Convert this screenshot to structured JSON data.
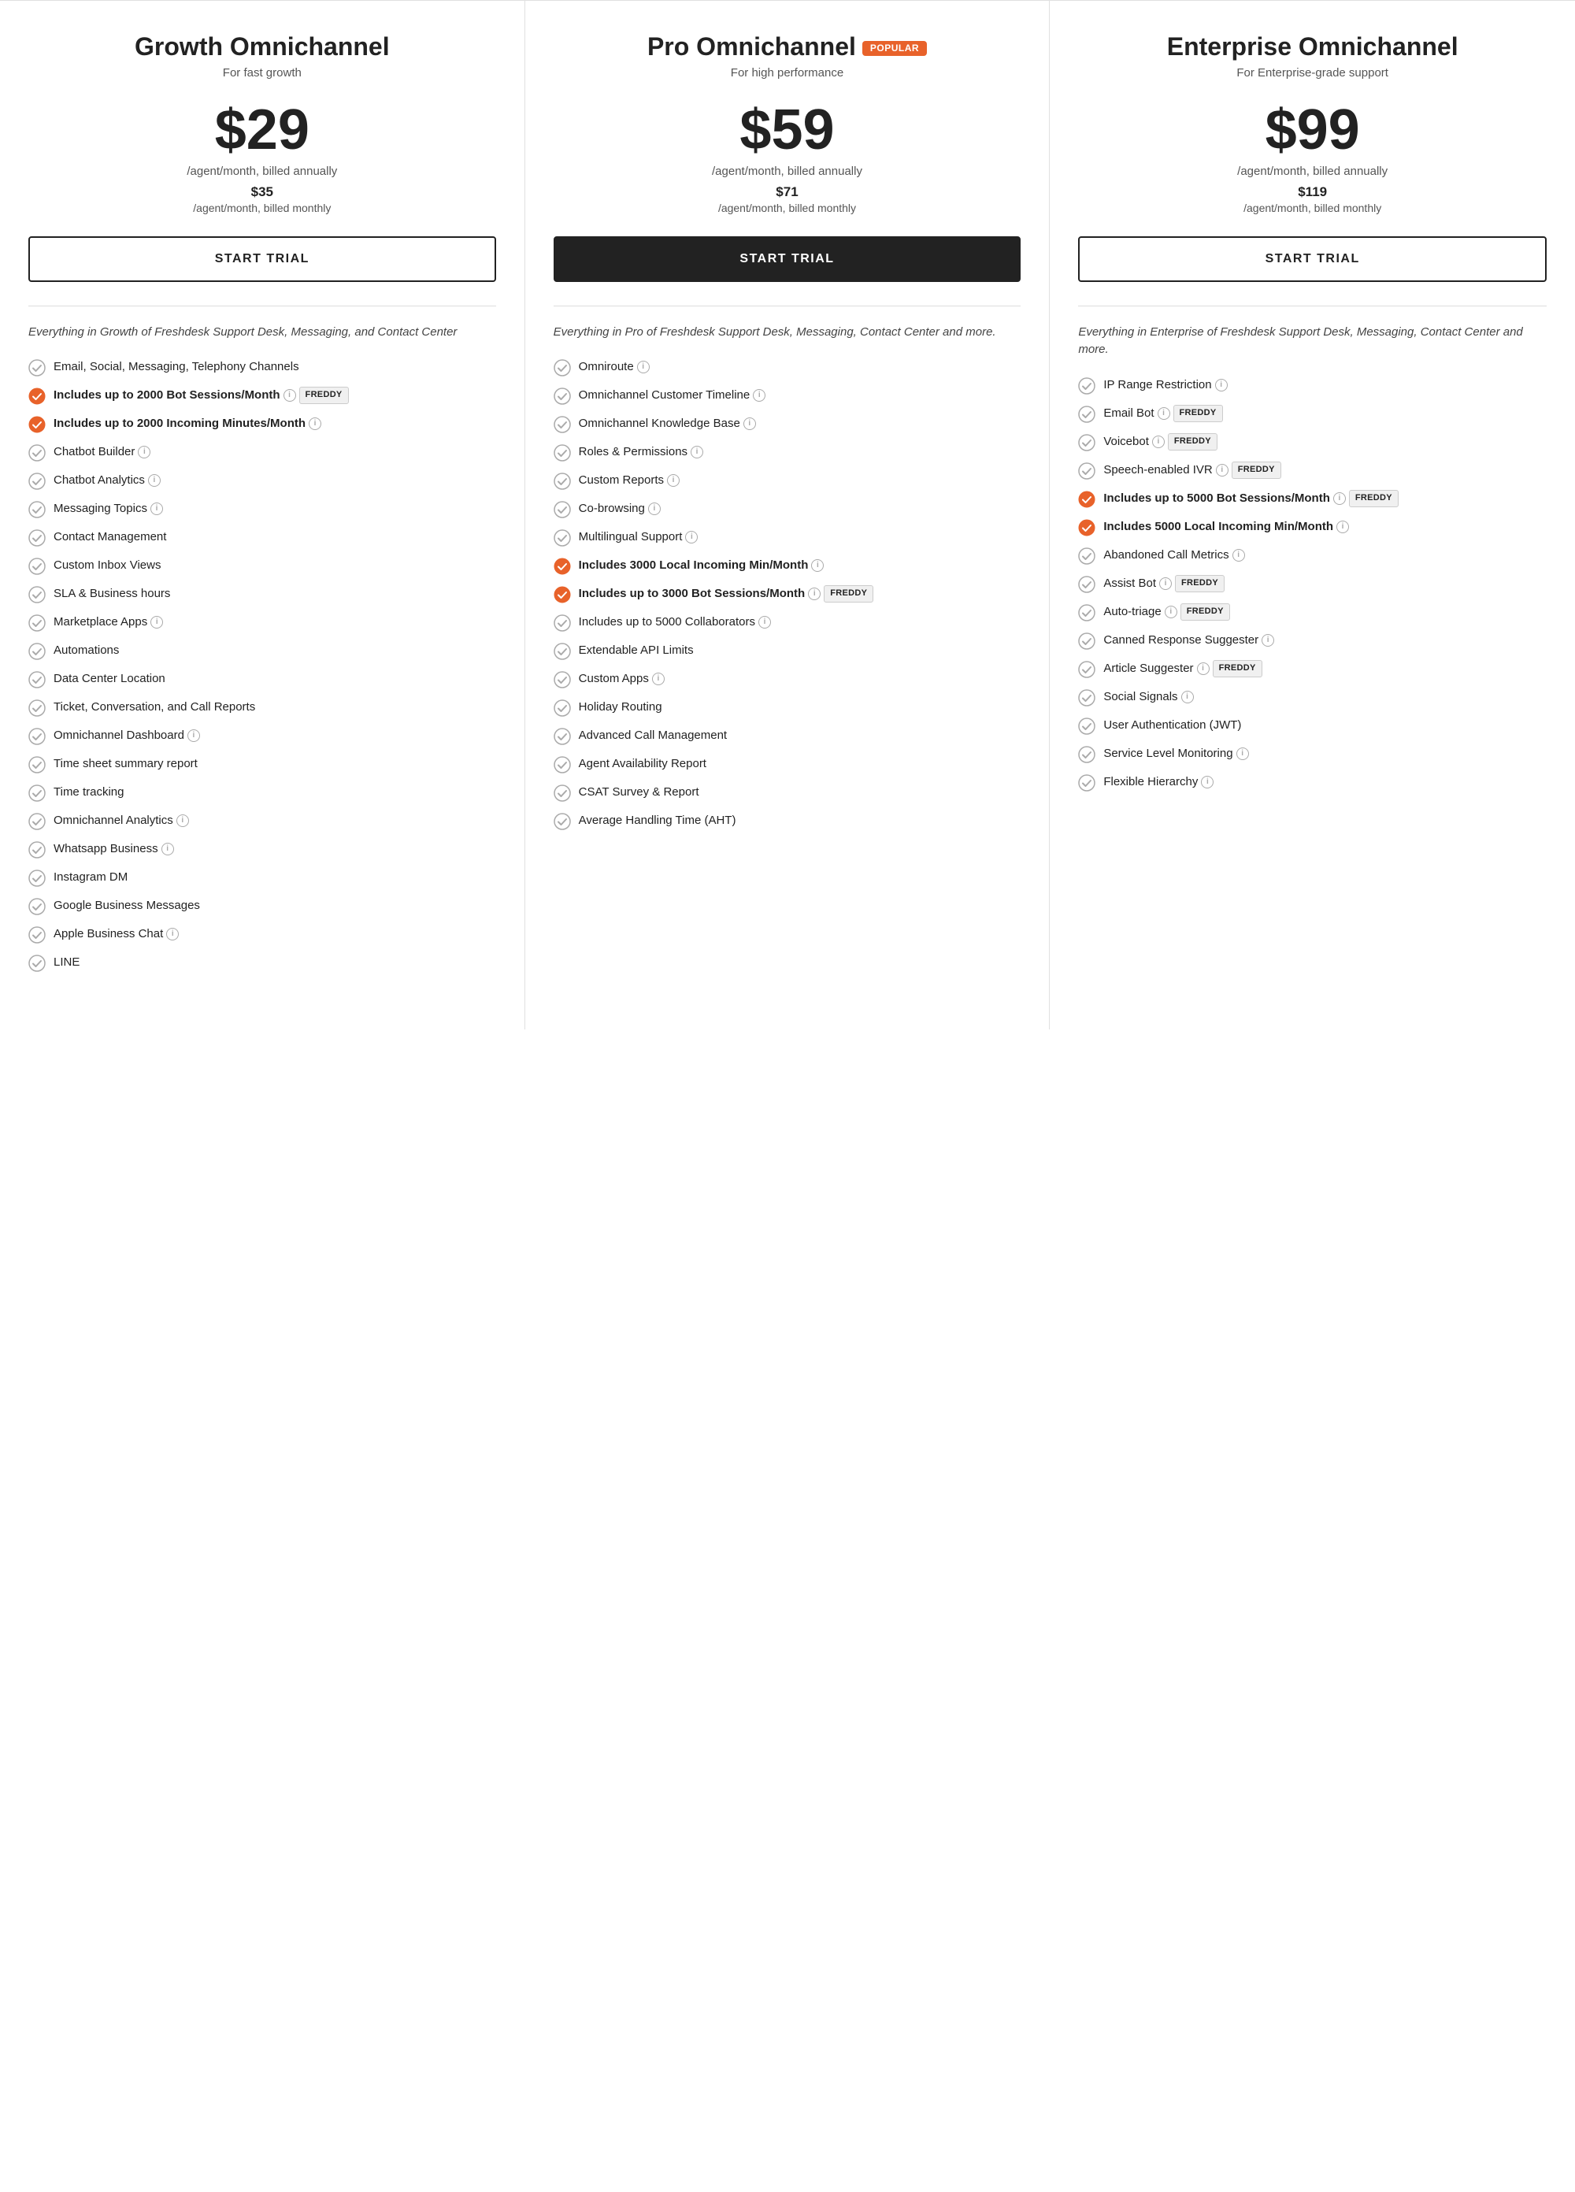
{
  "plans": [
    {
      "id": "growth",
      "name": "Growth Omnichannel",
      "tagline": "For fast growth",
      "popular": false,
      "price": "$29",
      "priceAnnual": "/agent/month, billed annually",
      "priceMonthlyVal": "$35",
      "priceMonthlyLabel": "/agent/month, billed monthly",
      "trialLabel": "START TRIAL",
      "trialStyle": "outline",
      "includes": "Everything in Growth of Freshdesk Support Desk, Messaging, and Contact Center",
      "features": [
        {
          "text": "Email, Social, Messaging, Telephony Channels",
          "bold": false,
          "orange": false,
          "info": false,
          "freddy": false
        },
        {
          "text": "Includes up to 2000 Bot Sessions/Month",
          "bold": true,
          "orange": true,
          "info": true,
          "freddy": true
        },
        {
          "text": "Includes up to 2000 Incoming Minutes/Month",
          "bold": true,
          "orange": true,
          "info": true,
          "freddy": false
        },
        {
          "text": "Chatbot Builder",
          "bold": false,
          "orange": false,
          "info": true,
          "freddy": false
        },
        {
          "text": "Chatbot Analytics",
          "bold": false,
          "orange": false,
          "info": true,
          "freddy": false
        },
        {
          "text": "Messaging Topics",
          "bold": false,
          "orange": false,
          "info": true,
          "freddy": false
        },
        {
          "text": "Contact Management",
          "bold": false,
          "orange": false,
          "info": false,
          "freddy": false
        },
        {
          "text": "Custom Inbox Views",
          "bold": false,
          "orange": false,
          "info": false,
          "freddy": false
        },
        {
          "text": "SLA & Business hours",
          "bold": false,
          "orange": false,
          "info": false,
          "freddy": false
        },
        {
          "text": "Marketplace Apps",
          "bold": false,
          "orange": false,
          "info": true,
          "freddy": false
        },
        {
          "text": "Automations",
          "bold": false,
          "orange": false,
          "info": false,
          "freddy": false
        },
        {
          "text": "Data Center Location",
          "bold": false,
          "orange": false,
          "info": false,
          "freddy": false
        },
        {
          "text": "Ticket, Conversation, and Call Reports",
          "bold": false,
          "orange": false,
          "info": false,
          "freddy": false
        },
        {
          "text": "Omnichannel Dashboard",
          "bold": false,
          "orange": false,
          "info": true,
          "freddy": false
        },
        {
          "text": "Time sheet summary report",
          "bold": false,
          "orange": false,
          "info": false,
          "freddy": false
        },
        {
          "text": "Time tracking",
          "bold": false,
          "orange": false,
          "info": false,
          "freddy": false
        },
        {
          "text": "Omnichannel Analytics",
          "bold": false,
          "orange": false,
          "info": true,
          "freddy": false
        },
        {
          "text": "Whatsapp Business",
          "bold": false,
          "orange": false,
          "info": true,
          "freddy": false
        },
        {
          "text": "Instagram DM",
          "bold": false,
          "orange": false,
          "info": false,
          "freddy": false
        },
        {
          "text": "Google Business Messages",
          "bold": false,
          "orange": false,
          "info": false,
          "freddy": false
        },
        {
          "text": "Apple Business Chat",
          "bold": false,
          "orange": false,
          "info": true,
          "freddy": false
        },
        {
          "text": "LINE",
          "bold": false,
          "orange": false,
          "info": false,
          "freddy": false
        }
      ]
    },
    {
      "id": "pro",
      "name": "Pro Omnichannel",
      "tagline": "For high performance",
      "popular": true,
      "price": "$59",
      "priceAnnual": "/agent/month, billed annually",
      "priceMonthlyVal": "$71",
      "priceMonthlyLabel": "/agent/month, billed monthly",
      "trialLabel": "START TRIAL",
      "trialStyle": "filled",
      "includes": "Everything in Pro of Freshdesk Support Desk, Messaging, Contact Center and more.",
      "features": [
        {
          "text": "Omniroute",
          "bold": false,
          "orange": false,
          "info": true,
          "freddy": false
        },
        {
          "text": "Omnichannel Customer Timeline",
          "bold": false,
          "orange": false,
          "info": true,
          "freddy": false
        },
        {
          "text": "Omnichannel Knowledge Base",
          "bold": false,
          "orange": false,
          "info": true,
          "freddy": false
        },
        {
          "text": "Roles & Permissions",
          "bold": false,
          "orange": false,
          "info": true,
          "freddy": false
        },
        {
          "text": "Custom Reports",
          "bold": false,
          "orange": false,
          "info": true,
          "freddy": false
        },
        {
          "text": "Co-browsing",
          "bold": false,
          "orange": false,
          "info": true,
          "freddy": false
        },
        {
          "text": "Multilingual Support",
          "bold": false,
          "orange": false,
          "info": true,
          "freddy": false
        },
        {
          "text": "Includes 3000 Local Incoming Min/Month",
          "bold": true,
          "orange": true,
          "info": true,
          "freddy": false
        },
        {
          "text": "Includes up to 3000 Bot Sessions/Month",
          "bold": true,
          "orange": true,
          "info": true,
          "freddy": true
        },
        {
          "text": "Includes up to 5000 Collaborators",
          "bold": false,
          "orange": false,
          "info": true,
          "freddy": false
        },
        {
          "text": "Extendable API Limits",
          "bold": false,
          "orange": false,
          "info": false,
          "freddy": false
        },
        {
          "text": "Custom Apps",
          "bold": false,
          "orange": false,
          "info": true,
          "freddy": false
        },
        {
          "text": "Holiday Routing",
          "bold": false,
          "orange": false,
          "info": false,
          "freddy": false
        },
        {
          "text": "Advanced Call Management",
          "bold": false,
          "orange": false,
          "info": false,
          "freddy": false
        },
        {
          "text": "Agent Availability Report",
          "bold": false,
          "orange": false,
          "info": false,
          "freddy": false
        },
        {
          "text": "CSAT Survey & Report",
          "bold": false,
          "orange": false,
          "info": false,
          "freddy": false
        },
        {
          "text": "Average Handling Time (AHT)",
          "bold": false,
          "orange": false,
          "info": false,
          "freddy": false
        }
      ]
    },
    {
      "id": "enterprise",
      "name": "Enterprise Omnichannel",
      "tagline": "For Enterprise-grade support",
      "popular": false,
      "price": "$99",
      "priceAnnual": "/agent/month, billed annually",
      "priceMonthlyVal": "$119",
      "priceMonthlyLabel": "/agent/month, billed monthly",
      "trialLabel": "START TRIAL",
      "trialStyle": "outline",
      "includes": "Everything in Enterprise of Freshdesk Support Desk, Messaging, Contact Center and more.",
      "features": [
        {
          "text": "IP Range Restriction",
          "bold": false,
          "orange": false,
          "info": true,
          "freddy": false
        },
        {
          "text": "Email Bot",
          "bold": false,
          "orange": false,
          "info": true,
          "freddy": true
        },
        {
          "text": "Voicebot",
          "bold": false,
          "orange": false,
          "info": true,
          "freddy": true
        },
        {
          "text": "Speech-enabled IVR",
          "bold": false,
          "orange": false,
          "info": true,
          "freddy": true
        },
        {
          "text": "Includes up to 5000 Bot Sessions/Month",
          "bold": true,
          "orange": true,
          "info": true,
          "freddy": true
        },
        {
          "text": "Includes 5000 Local Incoming Min/Month",
          "bold": true,
          "orange": true,
          "info": true,
          "freddy": false
        },
        {
          "text": "Abandoned Call Metrics",
          "bold": false,
          "orange": false,
          "info": true,
          "freddy": false
        },
        {
          "text": "Assist Bot",
          "bold": false,
          "orange": false,
          "info": true,
          "freddy": true
        },
        {
          "text": "Auto-triage",
          "bold": false,
          "orange": false,
          "info": true,
          "freddy": true
        },
        {
          "text": "Canned Response Suggester",
          "bold": false,
          "orange": false,
          "info": true,
          "freddy": false
        },
        {
          "text": "Article Suggester",
          "bold": false,
          "orange": false,
          "info": true,
          "freddy": true
        },
        {
          "text": "Social Signals",
          "bold": false,
          "orange": false,
          "info": true,
          "freddy": false
        },
        {
          "text": "User Authentication (JWT)",
          "bold": false,
          "orange": false,
          "info": false,
          "freddy": false
        },
        {
          "text": "Service Level Monitoring",
          "bold": false,
          "orange": false,
          "info": true,
          "freddy": false
        },
        {
          "text": "Flexible Hierarchy",
          "bold": false,
          "orange": false,
          "info": true,
          "freddy": false
        }
      ]
    }
  ],
  "labels": {
    "popular": "POPULAR",
    "freddy": "FREDDY",
    "info": "i"
  }
}
